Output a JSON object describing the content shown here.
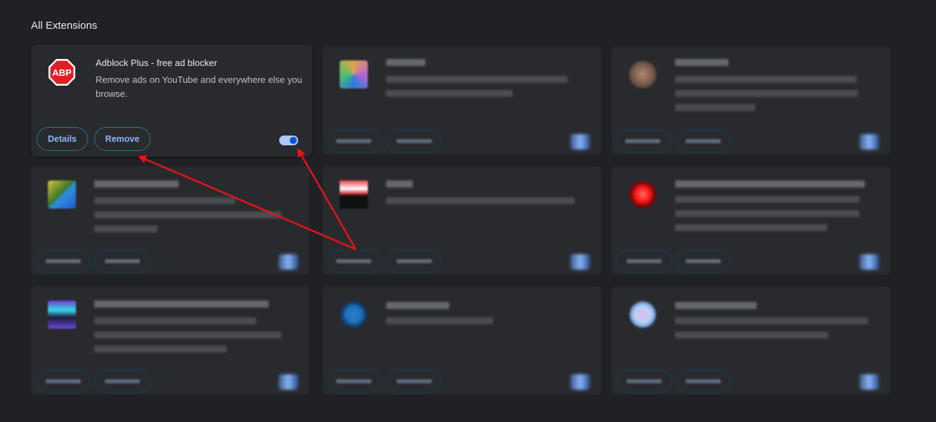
{
  "section": {
    "title": "All Extensions"
  },
  "extension": {
    "icon_text": "ABP",
    "name": "Adblock Plus - free ad blocker",
    "description": "Remove ads on YouTube and everywhere else you browse.",
    "details_label": "Details",
    "remove_label": "Remove",
    "enabled": true
  },
  "colors": {
    "background": "#202124",
    "card": "#292a2d",
    "accent": "#8ab4f8",
    "annotation_arrow": "#e8131b",
    "abp_red": "#e11e26"
  },
  "blurred_cards": [
    {
      "icon_colors": [
        "#e6a04a",
        "#b865d6",
        "#4fc46a",
        "#2a7be0"
      ]
    },
    {
      "icon_colors": [
        "#6b5244",
        "#b18a6e",
        "#3c2c24",
        "#8e6c54"
      ]
    },
    {
      "icon_colors": [
        "#2c8fe0",
        "#e3c23a",
        "#3a7a2a",
        "#2456c7"
      ]
    },
    {
      "icon_colors": [
        "#e24447",
        "#ffffff",
        "#111111",
        "#6b1a1a"
      ]
    },
    {
      "icon_colors": [
        "#ff1a1a",
        "#c60c0c",
        "#7a0707",
        "#ff6a6a"
      ]
    },
    {
      "icon_colors": [
        "#6c3fd1",
        "#38d8e6",
        "#1b1b3a",
        "#6d4ad8"
      ]
    },
    {
      "icon_colors": [
        "#1f6fb8",
        "#175a99",
        "#2a7fd0",
        "#0f3f6e"
      ]
    },
    {
      "icon_colors": [
        "#b6d4f2",
        "#e5b6f0",
        "#7fa7e6",
        "#c4a0e8"
      ]
    }
  ]
}
